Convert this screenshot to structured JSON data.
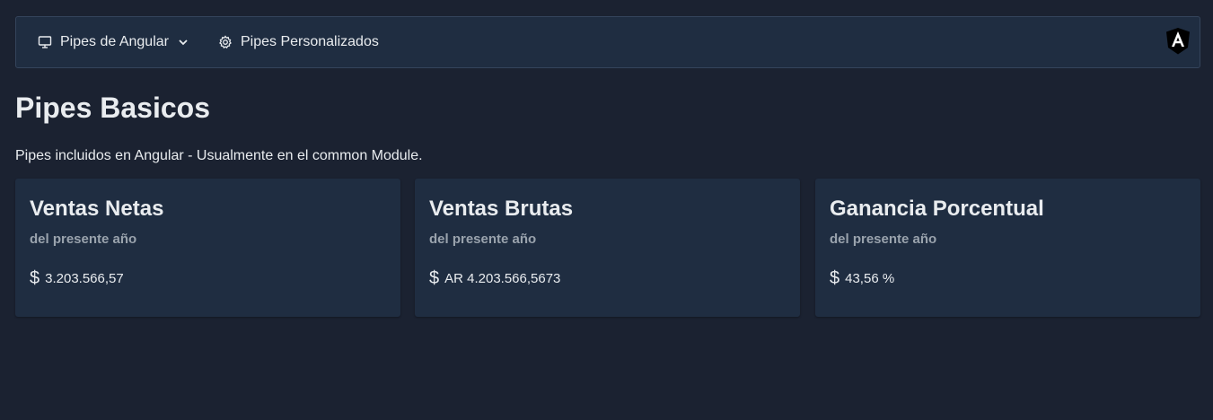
{
  "navbar": {
    "items": [
      {
        "label": "Pipes de Angular",
        "icon": "monitor-icon",
        "has_dropdown": true
      },
      {
        "label": "Pipes Personalizados",
        "icon": "gear-icon",
        "has_dropdown": false
      }
    ],
    "logo": "angular-logo"
  },
  "page": {
    "title": "Pipes Basicos",
    "subtitle": "Pipes incluidos en Angular - Usualmente en el common Module."
  },
  "cards": [
    {
      "title": "Ventas Netas",
      "subtitle": "del presente año",
      "currency_symbol": "$",
      "value": "3.203.566,57"
    },
    {
      "title": "Ventas Brutas",
      "subtitle": "del presente año",
      "currency_symbol": "$",
      "value": "AR 4.203.566,5673"
    },
    {
      "title": "Ganancia Porcentual",
      "subtitle": "del presente año",
      "currency_symbol": "$",
      "value": "43,56 %"
    }
  ],
  "colors": {
    "background": "#1b2231",
    "surface": "#1f2d41",
    "text": "#e9ecef",
    "muted": "#9aa3ad"
  }
}
